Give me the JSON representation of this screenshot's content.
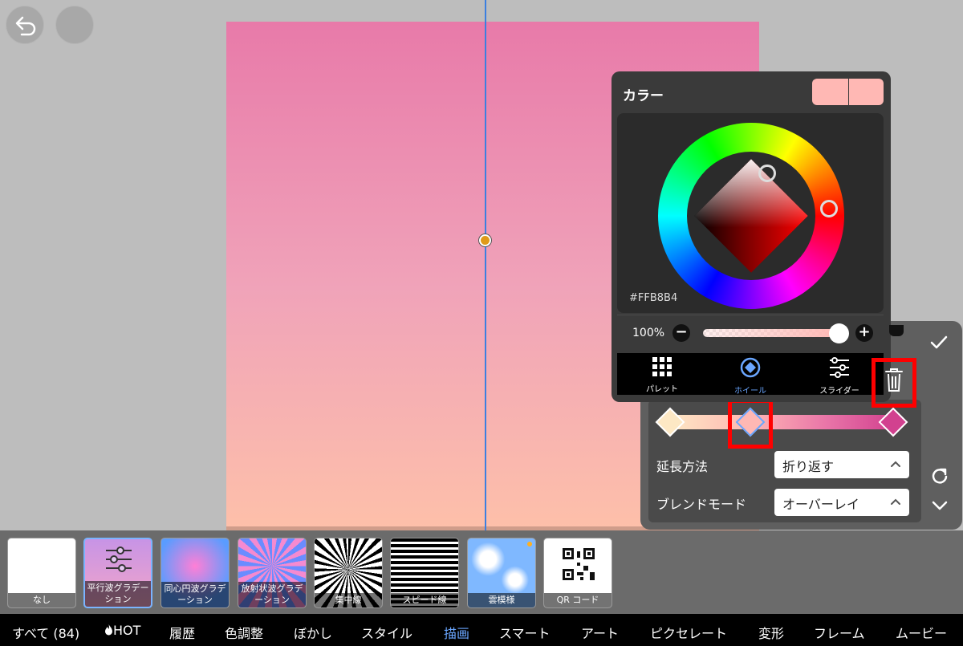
{
  "colors": {
    "gradient_start": "#fde8c4",
    "selected_color": "#ffb8b4",
    "gradient_end": "#d2418f",
    "accent": "#6aa6ff",
    "highlight": "#ff0000"
  },
  "icons": {
    "undo": "undo-icon",
    "confirm": "check-icon",
    "refresh": "refresh-icon",
    "collapse": "chevron-down-icon",
    "trash": "trash-icon"
  },
  "color_panel": {
    "title": "カラー",
    "hex": "#FFB8B4",
    "opacity": "100%",
    "opacity_level": 1.0,
    "minus_label": "−",
    "plus_label": "+",
    "modes": [
      {
        "label": "パレット"
      },
      {
        "label": "ホイール",
        "active": true
      },
      {
        "label": "スライダー"
      }
    ]
  },
  "gradient_panel": {
    "extension_label": "延長方法",
    "extension_value": "折り返す",
    "blend_label": "ブレンドモード",
    "blend_value": "オーバーレイ"
  },
  "filters": [
    {
      "label": "なし"
    },
    {
      "label": "平行波グラデーション",
      "selected": true
    },
    {
      "label": "同心円波グラデーション"
    },
    {
      "label": "放射状波グラデーション"
    },
    {
      "label": "集中線"
    },
    {
      "label": "スピード線"
    },
    {
      "label": "雲模様"
    },
    {
      "label": "QR コード"
    }
  ],
  "categories": [
    {
      "label": "すべて (84)"
    },
    {
      "label": "HOT"
    },
    {
      "label": "履歴"
    },
    {
      "label": "色調整"
    },
    {
      "label": "ぼかし"
    },
    {
      "label": "スタイル"
    },
    {
      "label": "描画",
      "active": true
    },
    {
      "label": "スマート"
    },
    {
      "label": "アート"
    },
    {
      "label": "ピクセレート"
    },
    {
      "label": "変形"
    },
    {
      "label": "フレーム"
    },
    {
      "label": "ムービー"
    }
  ]
}
